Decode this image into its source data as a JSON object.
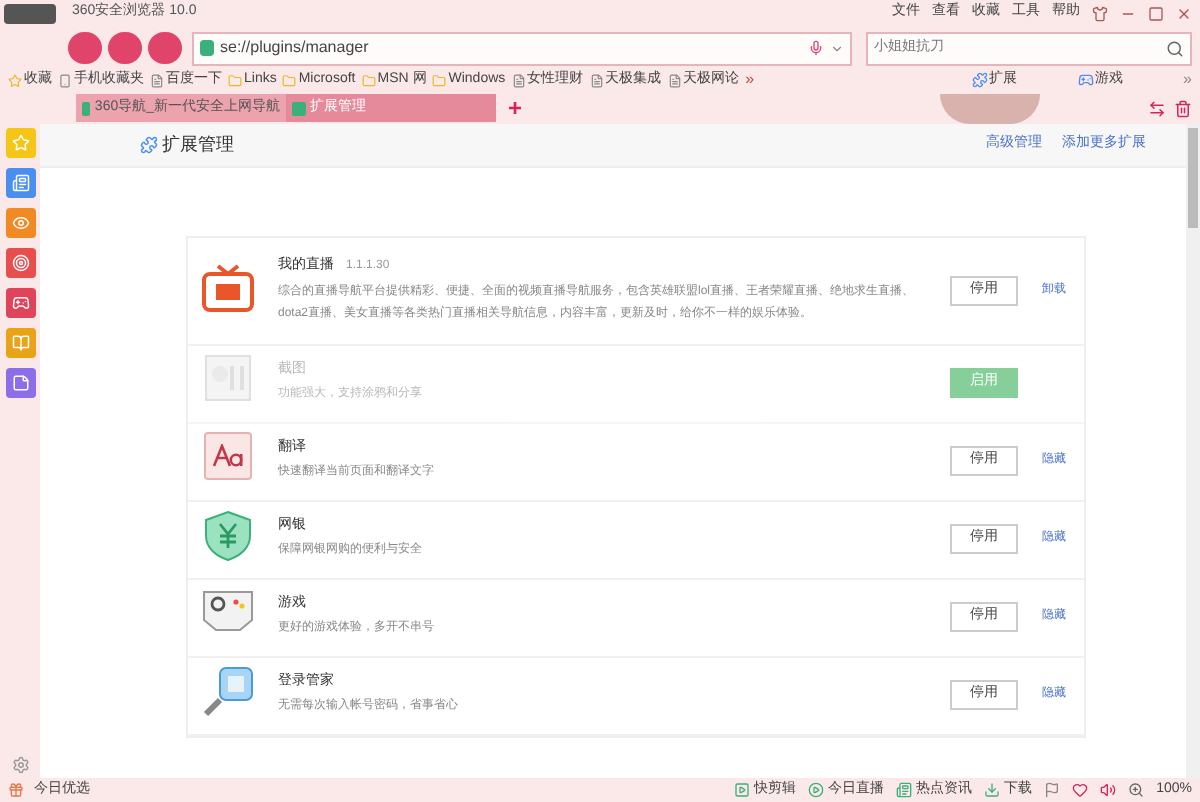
{
  "window": {
    "title": "360安全浏览器 10.0",
    "menu": [
      "文件",
      "查看",
      "收藏",
      "工具",
      "帮助"
    ]
  },
  "address_bar": {
    "value": "se://plugins/manager"
  },
  "search": {
    "placeholder": "小姐姐抗刀"
  },
  "bookmarks": [
    {
      "label": "收藏",
      "kind": "star"
    },
    {
      "label": "手机收藏夹",
      "kind": "phone"
    },
    {
      "label": "百度一下",
      "kind": "page"
    },
    {
      "label": "Links",
      "kind": "folder"
    },
    {
      "label": "Microsoft",
      "kind": "folder"
    },
    {
      "label": "MSN 网",
      "kind": "folder"
    },
    {
      "label": "Windows",
      "kind": "folder"
    },
    {
      "label": "女性理财",
      "kind": "page"
    },
    {
      "label": "天极集成",
      "kind": "page"
    },
    {
      "label": "天极网论",
      "kind": "page"
    }
  ],
  "bookmarks_more": "»",
  "bookmarks_right": [
    {
      "label": "扩展",
      "kind": "puzzle"
    },
    {
      "label": "游戏",
      "kind": "game"
    }
  ],
  "bookmarks_right_more": "»",
  "tabs": [
    {
      "label": "360导航_新一代安全上网导航",
      "selected": false
    },
    {
      "label": "扩展管理",
      "selected": true
    }
  ],
  "new_tab": "+",
  "page": {
    "title": "扩展管理",
    "links": [
      "高级管理",
      "添加更多扩展"
    ]
  },
  "extensions": [
    {
      "name": "我的直播",
      "version": "1.1.1.30",
      "description": "综合的直播导航平台提供精彩、便捷、全面的视频直播导航服务，包含英雄联盟lol直播、王者荣耀直播、绝地求生直播、dota2直播、美女直播等各类热门直播相关导航信息，内容丰富，更新及时，给你不一样的娱乐体验。",
      "kind": "tv",
      "enabled": true,
      "button": "停用",
      "link": "卸载"
    },
    {
      "name": "截图",
      "description": "功能强大，支持涂鸦和分享",
      "kind": "scissors",
      "enabled": false,
      "button": "启用"
    },
    {
      "name": "翻译",
      "description": "快速翻译当前页面和翻译文字",
      "kind": "translate",
      "enabled": true,
      "button": "停用",
      "link": "隐藏"
    },
    {
      "name": "网银",
      "description": "保障网银网购的便利与安全",
      "kind": "shield",
      "enabled": true,
      "button": "停用",
      "link": "隐藏"
    },
    {
      "name": "游戏",
      "description": "更好的游戏体验，多开不串号",
      "kind": "gamepad",
      "enabled": true,
      "button": "停用",
      "link": "隐藏"
    },
    {
      "name": "登录管家",
      "description": "无需每次输入帐号密码，省事省心",
      "kind": "key",
      "enabled": true,
      "button": "停用",
      "link": "隐藏"
    }
  ],
  "sidebar": [
    {
      "kind": "star"
    },
    {
      "kind": "news"
    },
    {
      "kind": "weibo"
    },
    {
      "kind": "target"
    },
    {
      "kind": "game"
    },
    {
      "kind": "book"
    },
    {
      "kind": "note"
    }
  ],
  "status_bar": {
    "left": "今日优选",
    "items": [
      {
        "label": "快剪辑",
        "kind": "video"
      },
      {
        "label": "今日直播",
        "kind": "play"
      },
      {
        "label": "热点资讯",
        "kind": "news"
      },
      {
        "label": "下载",
        "kind": "download"
      }
    ],
    "zoom": "100%"
  }
}
